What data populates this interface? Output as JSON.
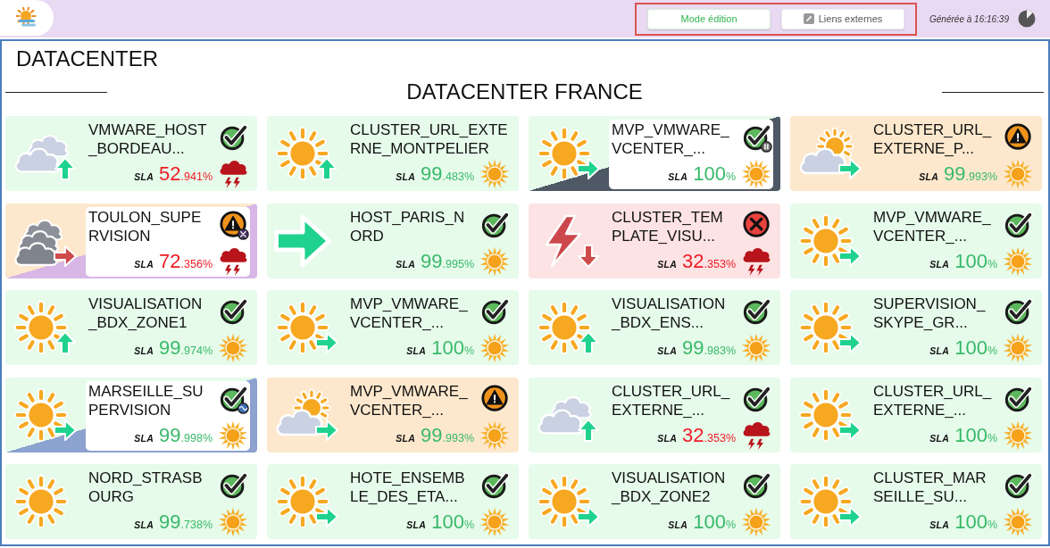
{
  "header": {
    "buttons": [
      {
        "kind": "mode",
        "label": "Mode édition"
      },
      {
        "kind": "links",
        "label": "Liens externes"
      }
    ],
    "generated": "Générée à 16:16:39"
  },
  "page_title": "DATACENTER",
  "section": {
    "title": "DATACENTER FRANCE",
    "tiles": [
      {
        "name": "VMWARE_HOST_BORDEAU...",
        "status": {
          "kind": "check"
        },
        "weather": {
          "kind": "cloud"
        },
        "trend": {
          "kind": "up",
          "color": "#1fd38f"
        },
        "sla": {
          "label": "SLA",
          "value": "52",
          "suffix": ".941%",
          "color": "#ee1c25"
        },
        "sla_icon": {
          "kind": "storm"
        }
      },
      {
        "name": "CLUSTER_URL_EXTERNE_MONTPELIER",
        "weather": {
          "kind": "sun"
        },
        "trend": {
          "kind": "up",
          "color": "#1fd38f"
        },
        "sla": {
          "label": "SLA",
          "value": "99",
          "suffix": ".483%",
          "color": "#38b96a"
        },
        "sla_icon": {
          "kind": "sun"
        }
      },
      {
        "name": "MVP_VMWARE_VCENTER_...",
        "status": {
          "kind": "check"
        },
        "flag": {
          "kind": "pause"
        },
        "weather": {
          "kind": "sun"
        },
        "trend": {
          "kind": "right",
          "color": "#1fd38f"
        },
        "sla": {
          "label": "SLA",
          "value": "100",
          "suffix": "%",
          "color": "#38b96a"
        },
        "sla_icon": {
          "kind": "sun"
        }
      },
      {
        "name": "CLUSTER_URL_EXTERNE_P...",
        "status": {
          "kind": "warning"
        },
        "weather": {
          "kind": "suncloud"
        },
        "trend": {
          "kind": "right",
          "color": "#1fd38f"
        },
        "sla": {
          "label": "SLA",
          "value": "99",
          "suffix": ".993%",
          "color": "#38b96a"
        },
        "sla_icon": {
          "kind": "sun"
        }
      },
      {
        "name": "TOULON_SUPERVISION",
        "status": {
          "kind": "warning"
        },
        "flag": {
          "kind": "tools"
        },
        "weather": {
          "kind": "darkclouds"
        },
        "trend": {
          "kind": "right",
          "color": "#cf4a4a"
        },
        "sla": {
          "label": "SLA",
          "value": "72",
          "suffix": ".356%",
          "color": "#ee1c25"
        },
        "sla_icon": {
          "kind": "storm"
        }
      },
      {
        "name": "HOST_PARIS_NORD",
        "status": {
          "kind": "check"
        },
        "trend": {
          "kind": "right",
          "color": "#1fd38f"
        },
        "sla": {
          "label": "SLA",
          "value": "99",
          "suffix": ".995%",
          "color": "#38b96a"
        },
        "sla_icon": {
          "kind": "sun"
        }
      },
      {
        "name": "CLUSTER_TEMPLATE_VISU...",
        "status": {
          "kind": "error"
        },
        "weather": {
          "kind": "lightning"
        },
        "trend": {
          "kind": "down",
          "color": "#cf4a4a"
        },
        "sla": {
          "label": "SLA",
          "value": "32",
          "suffix": ".353%",
          "color": "#ee1c25"
        },
        "sla_icon": {
          "kind": "storm"
        }
      },
      {
        "name": "MVP_VMWARE_VCENTER_...",
        "status": {
          "kind": "check"
        },
        "weather": {
          "kind": "sun"
        },
        "trend": {
          "kind": "right",
          "color": "#1fd38f"
        },
        "sla": {
          "label": "SLA",
          "value": "100",
          "suffix": "%",
          "color": "#38b96a"
        },
        "sla_icon": {
          "kind": "sun"
        }
      },
      {
        "name": "VISUALISATION_BDX_ZONE1",
        "status": {
          "kind": "check"
        },
        "weather": {
          "kind": "sun"
        },
        "trend": {
          "kind": "up",
          "color": "#1fd38f"
        },
        "sla": {
          "label": "SLA",
          "value": "99",
          "suffix": ".974%",
          "color": "#38b96a"
        },
        "sla_icon": {
          "kind": "sun"
        }
      },
      {
        "name": "MVP_VMWARE_VCENTER_...",
        "status": {
          "kind": "check"
        },
        "weather": {
          "kind": "sun"
        },
        "trend": {
          "kind": "right",
          "color": "#1fd38f"
        },
        "sla": {
          "label": "SLA",
          "value": "100",
          "suffix": "%",
          "color": "#38b96a"
        },
        "sla_icon": {
          "kind": "sun"
        }
      },
      {
        "name": "VISUALISATION_BDX_ENS...",
        "status": {
          "kind": "check"
        },
        "weather": {
          "kind": "sun"
        },
        "trend": {
          "kind": "up",
          "color": "#1fd38f"
        },
        "sla": {
          "label": "SLA",
          "value": "99",
          "suffix": ".983%",
          "color": "#38b96a"
        },
        "sla_icon": {
          "kind": "sun"
        }
      },
      {
        "name": "SUPERVISION_SKYPE_GR...",
        "status": {
          "kind": "check"
        },
        "weather": {
          "kind": "sun"
        },
        "trend": {
          "kind": "right",
          "color": "#1fd38f"
        },
        "sla": {
          "label": "SLA",
          "value": "100",
          "suffix": "%",
          "color": "#38b96a"
        },
        "sla_icon": {
          "kind": "sun"
        }
      },
      {
        "name": "MARSEILLE_SUPERVISION",
        "status": {
          "kind": "check"
        },
        "flag": {
          "kind": "wave"
        },
        "weather": {
          "kind": "sun"
        },
        "trend": {
          "kind": "right",
          "color": "#1fd38f"
        },
        "sla": {
          "label": "SLA",
          "value": "99",
          "suffix": ".998%",
          "color": "#38b96a"
        },
        "sla_icon": {
          "kind": "sun"
        }
      },
      {
        "name": "MVP_VMWARE_VCENTER_...",
        "status": {
          "kind": "warning"
        },
        "weather": {
          "kind": "suncloud"
        },
        "trend": {
          "kind": "right",
          "color": "#1fd38f"
        },
        "sla": {
          "label": "SLA",
          "value": "99",
          "suffix": ".993%",
          "color": "#38b96a"
        },
        "sla_icon": {
          "kind": "sun"
        }
      },
      {
        "name": "CLUSTER_URL_EXTERNE_...",
        "status": {
          "kind": "check"
        },
        "weather": {
          "kind": "cloud"
        },
        "trend": {
          "kind": "up",
          "color": "#1fd38f"
        },
        "sla": {
          "label": "SLA",
          "value": "32",
          "suffix": ".353%",
          "color": "#ee1c25"
        },
        "sla_icon": {
          "kind": "storm"
        }
      },
      {
        "name": "CLUSTER_URL_EXTERNE_...",
        "status": {
          "kind": "check"
        },
        "weather": {
          "kind": "sun"
        },
        "trend": {
          "kind": "right",
          "color": "#1fd38f"
        },
        "sla": {
          "label": "SLA",
          "value": "100",
          "suffix": "%",
          "color": "#38b96a"
        },
        "sla_icon": {
          "kind": "sun"
        }
      },
      {
        "name": "NORD_STRASBOURG",
        "status": {
          "kind": "check"
        },
        "weather": {
          "kind": "sun"
        },
        "sla": {
          "label": "SLA",
          "value": "99",
          "suffix": ".738%",
          "color": "#38b96a"
        },
        "sla_icon": {
          "kind": "sun"
        }
      },
      {
        "name": "HOTE_ENSEMBLE_DES_ETA...",
        "status": {
          "kind": "check"
        },
        "weather": {
          "kind": "sun"
        },
        "trend": {
          "kind": "right",
          "color": "#1fd38f"
        },
        "sla": {
          "label": "SLA",
          "value": "100",
          "suffix": "%",
          "color": "#38b96a"
        },
        "sla_icon": {
          "kind": "sun"
        }
      },
      {
        "name": "VISUALISATION_BDX_ZONE2",
        "status": {
          "kind": "check"
        },
        "weather": {
          "kind": "sun"
        },
        "trend": {
          "kind": "right",
          "color": "#1fd38f"
        },
        "sla": {
          "label": "SLA",
          "value": "100",
          "suffix": "%",
          "color": "#38b96a"
        },
        "sla_icon": {
          "kind": "sun"
        }
      },
      {
        "name": "CLUSTER_MARSEILLE_SU...",
        "status": {
          "kind": "check"
        },
        "weather": {
          "kind": "sun"
        },
        "trend": {
          "kind": "right",
          "color": "#1fd38f"
        },
        "sla": {
          "label": "SLA",
          "value": "100",
          "suffix": "%",
          "color": "#38b96a"
        },
        "sla_icon": {
          "kind": "sun"
        }
      }
    ]
  }
}
